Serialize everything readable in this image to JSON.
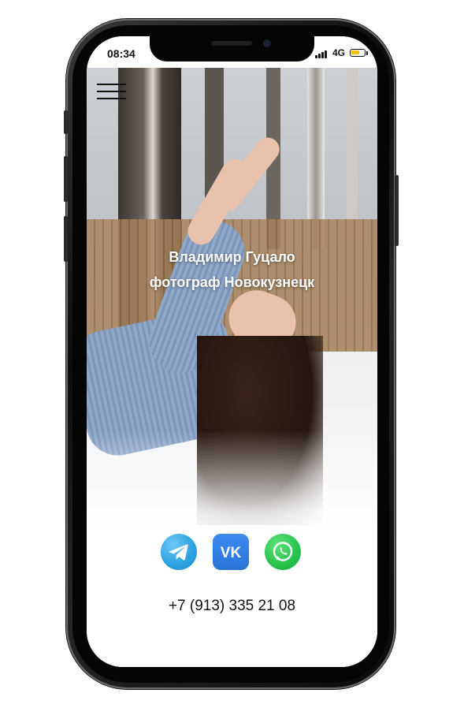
{
  "status_bar": {
    "time": "08:34",
    "network": "4G",
    "battery_color": "#f2c200"
  },
  "menu": {
    "icon": "hamburger-menu-icon"
  },
  "hero": {
    "title_line1": "Владимир Гуцало",
    "title_line2": "фотограф Новокузнецк"
  },
  "socials": [
    {
      "name": "telegram",
      "icon": "telegram-icon",
      "color": "#2fa4e2"
    },
    {
      "name": "vk",
      "icon": "vk-icon",
      "color": "#2a72d6"
    },
    {
      "name": "whatsapp",
      "icon": "whatsapp-icon",
      "color": "#27c24c"
    }
  ],
  "contact": {
    "phone": "+7 (913) 335 21 08"
  }
}
